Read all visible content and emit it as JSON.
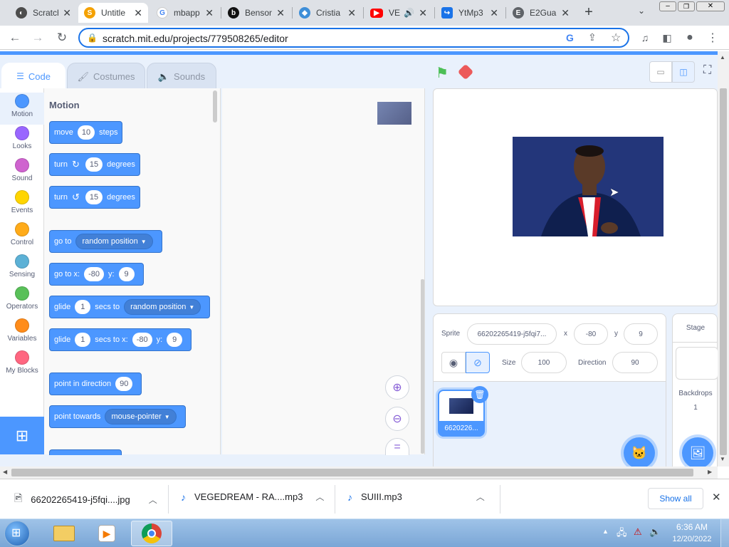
{
  "browser": {
    "tabs": [
      {
        "title": "Scratch",
        "fav": "S",
        "color": "#f4a100"
      },
      {
        "title": "Untitle",
        "fav": "S",
        "color": "#f4a100",
        "active": true
      },
      {
        "title": "mbapp",
        "fav": "G",
        "color": "#4285f4"
      },
      {
        "title": "Benson",
        "fav": "b",
        "color": "#111111"
      },
      {
        "title": "Cristia",
        "fav": "◈",
        "color": "#3d8ed8"
      },
      {
        "title": "VE",
        "fav": "▶",
        "color": "#ff0000"
      },
      {
        "title": "YtMp3",
        "fav": "↪",
        "color": "#1a73e8"
      },
      {
        "title": "E2Gua",
        "fav": "E",
        "color": "#5f6368"
      }
    ],
    "url": "scratch.mit.edu/projects/779508265/editor"
  },
  "editor": {
    "tabs": [
      "Code",
      "Costumes",
      "Sounds"
    ],
    "categories": [
      {
        "label": "Motion",
        "color": "#4c97ff"
      },
      {
        "label": "Looks",
        "color": "#9966ff"
      },
      {
        "label": "Sound",
        "color": "#cf63cf"
      },
      {
        "label": "Events",
        "color": "#ffd500"
      },
      {
        "label": "Control",
        "color": "#ffab19"
      },
      {
        "label": "Sensing",
        "color": "#5cb1d6"
      },
      {
        "label": "Operators",
        "color": "#59c059"
      },
      {
        "label": "Variables",
        "color": "#ff8c1a"
      },
      {
        "label": "My Blocks",
        "color": "#ff6680"
      }
    ],
    "palette_title": "Motion",
    "blocks": {
      "move": {
        "t1": "move",
        "v1": "10",
        "t2": "steps"
      },
      "turn_cw": {
        "t1": "turn",
        "v1": "15",
        "t2": "degrees"
      },
      "turn_ccw": {
        "t1": "turn",
        "v1": "15",
        "t2": "degrees"
      },
      "goto": {
        "t1": "go to",
        "d1": "random position"
      },
      "gotoxy": {
        "t1": "go to x:",
        "v1": "-80",
        "t2": "y:",
        "v2": "9"
      },
      "glide": {
        "t1": "glide",
        "v1": "1",
        "t2": "secs to",
        "d1": "random position"
      },
      "glidexy": {
        "t1": "glide",
        "v1": "1",
        "t2": "secs to x:",
        "v2": "-80",
        "t3": "y:",
        "v3": "9"
      },
      "point_dir": {
        "t1": "point in direction",
        "v1": "90"
      },
      "point_towards": {
        "t1": "point towards",
        "d1": "mouse-pointer"
      }
    },
    "sprite": {
      "label": "Sprite",
      "name": "66202265419-j5fqi7...",
      "x_label": "x",
      "x": "-80",
      "y_label": "y",
      "y": "9",
      "size_label": "Size",
      "size": "100",
      "direction_label": "Direction",
      "direction": "90",
      "thumb_label": "6620226..."
    },
    "stage_panel": {
      "title": "Stage",
      "backdrops_label": "Backdrops",
      "backdrops_count": "1"
    }
  },
  "downloads": {
    "items": [
      "66202265419-j5fqi....jpg",
      "VEGEDREAM - RA....mp3",
      "SUIII.mp3"
    ],
    "show_all": "Show all"
  },
  "taskbar": {
    "time": "6:36 AM",
    "date": "12/20/2022"
  }
}
